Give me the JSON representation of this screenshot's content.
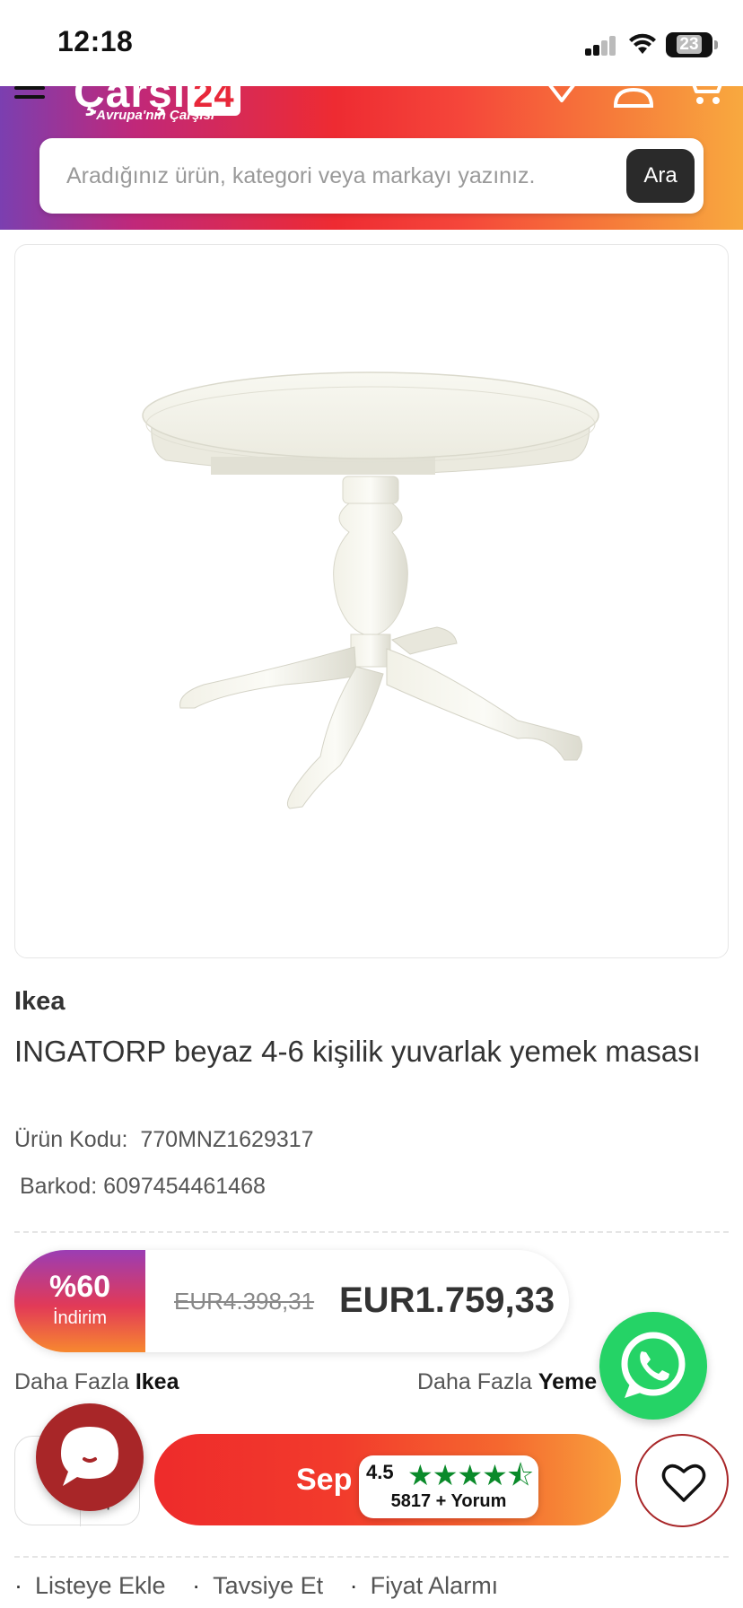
{
  "status_bar": {
    "time": "12:18",
    "battery": "23"
  },
  "header": {
    "logo_text": "Çarşı",
    "logo_number": "24",
    "tagline": "\"Avrupa'nın Çarşısı\"",
    "search_placeholder": "Aradığınız ürün, kategori veya markayı yazınız.",
    "search_button": "Ara"
  },
  "product": {
    "brand": "Ikea",
    "title": "INGATORP beyaz 4-6 kişilik yuvarlak yemek masası",
    "code_label": "Ürün Kodu:",
    "code_value": "770MNZ1629317",
    "barcode_label": "Barkod:",
    "barcode_value": "6097454461468"
  },
  "price": {
    "discount_pct": "%60",
    "discount_label": "İndirim",
    "old_price": "EUR4.398,31",
    "new_price": "EUR1.759,33"
  },
  "more_links": {
    "left_prefix": "Daha Fazla",
    "left_brand": "Ikea",
    "right_prefix": "Daha Fazla",
    "right_category": "Yeme"
  },
  "actions": {
    "cart_label": "Sep",
    "rating_score": "4.5",
    "rating_stars": "★★★★⯪",
    "rating_count": "5817 + Yorum",
    "qty_plus": "+"
  },
  "bottom_links": [
    "Listeye Ekle",
    "Tavsiye Et",
    "Fiyat Alarmı"
  ],
  "colors": {
    "accent_red": "#ee2b2b",
    "whatsapp": "#25d366",
    "chat": "#a82628",
    "star_green": "#0a8a2a"
  }
}
